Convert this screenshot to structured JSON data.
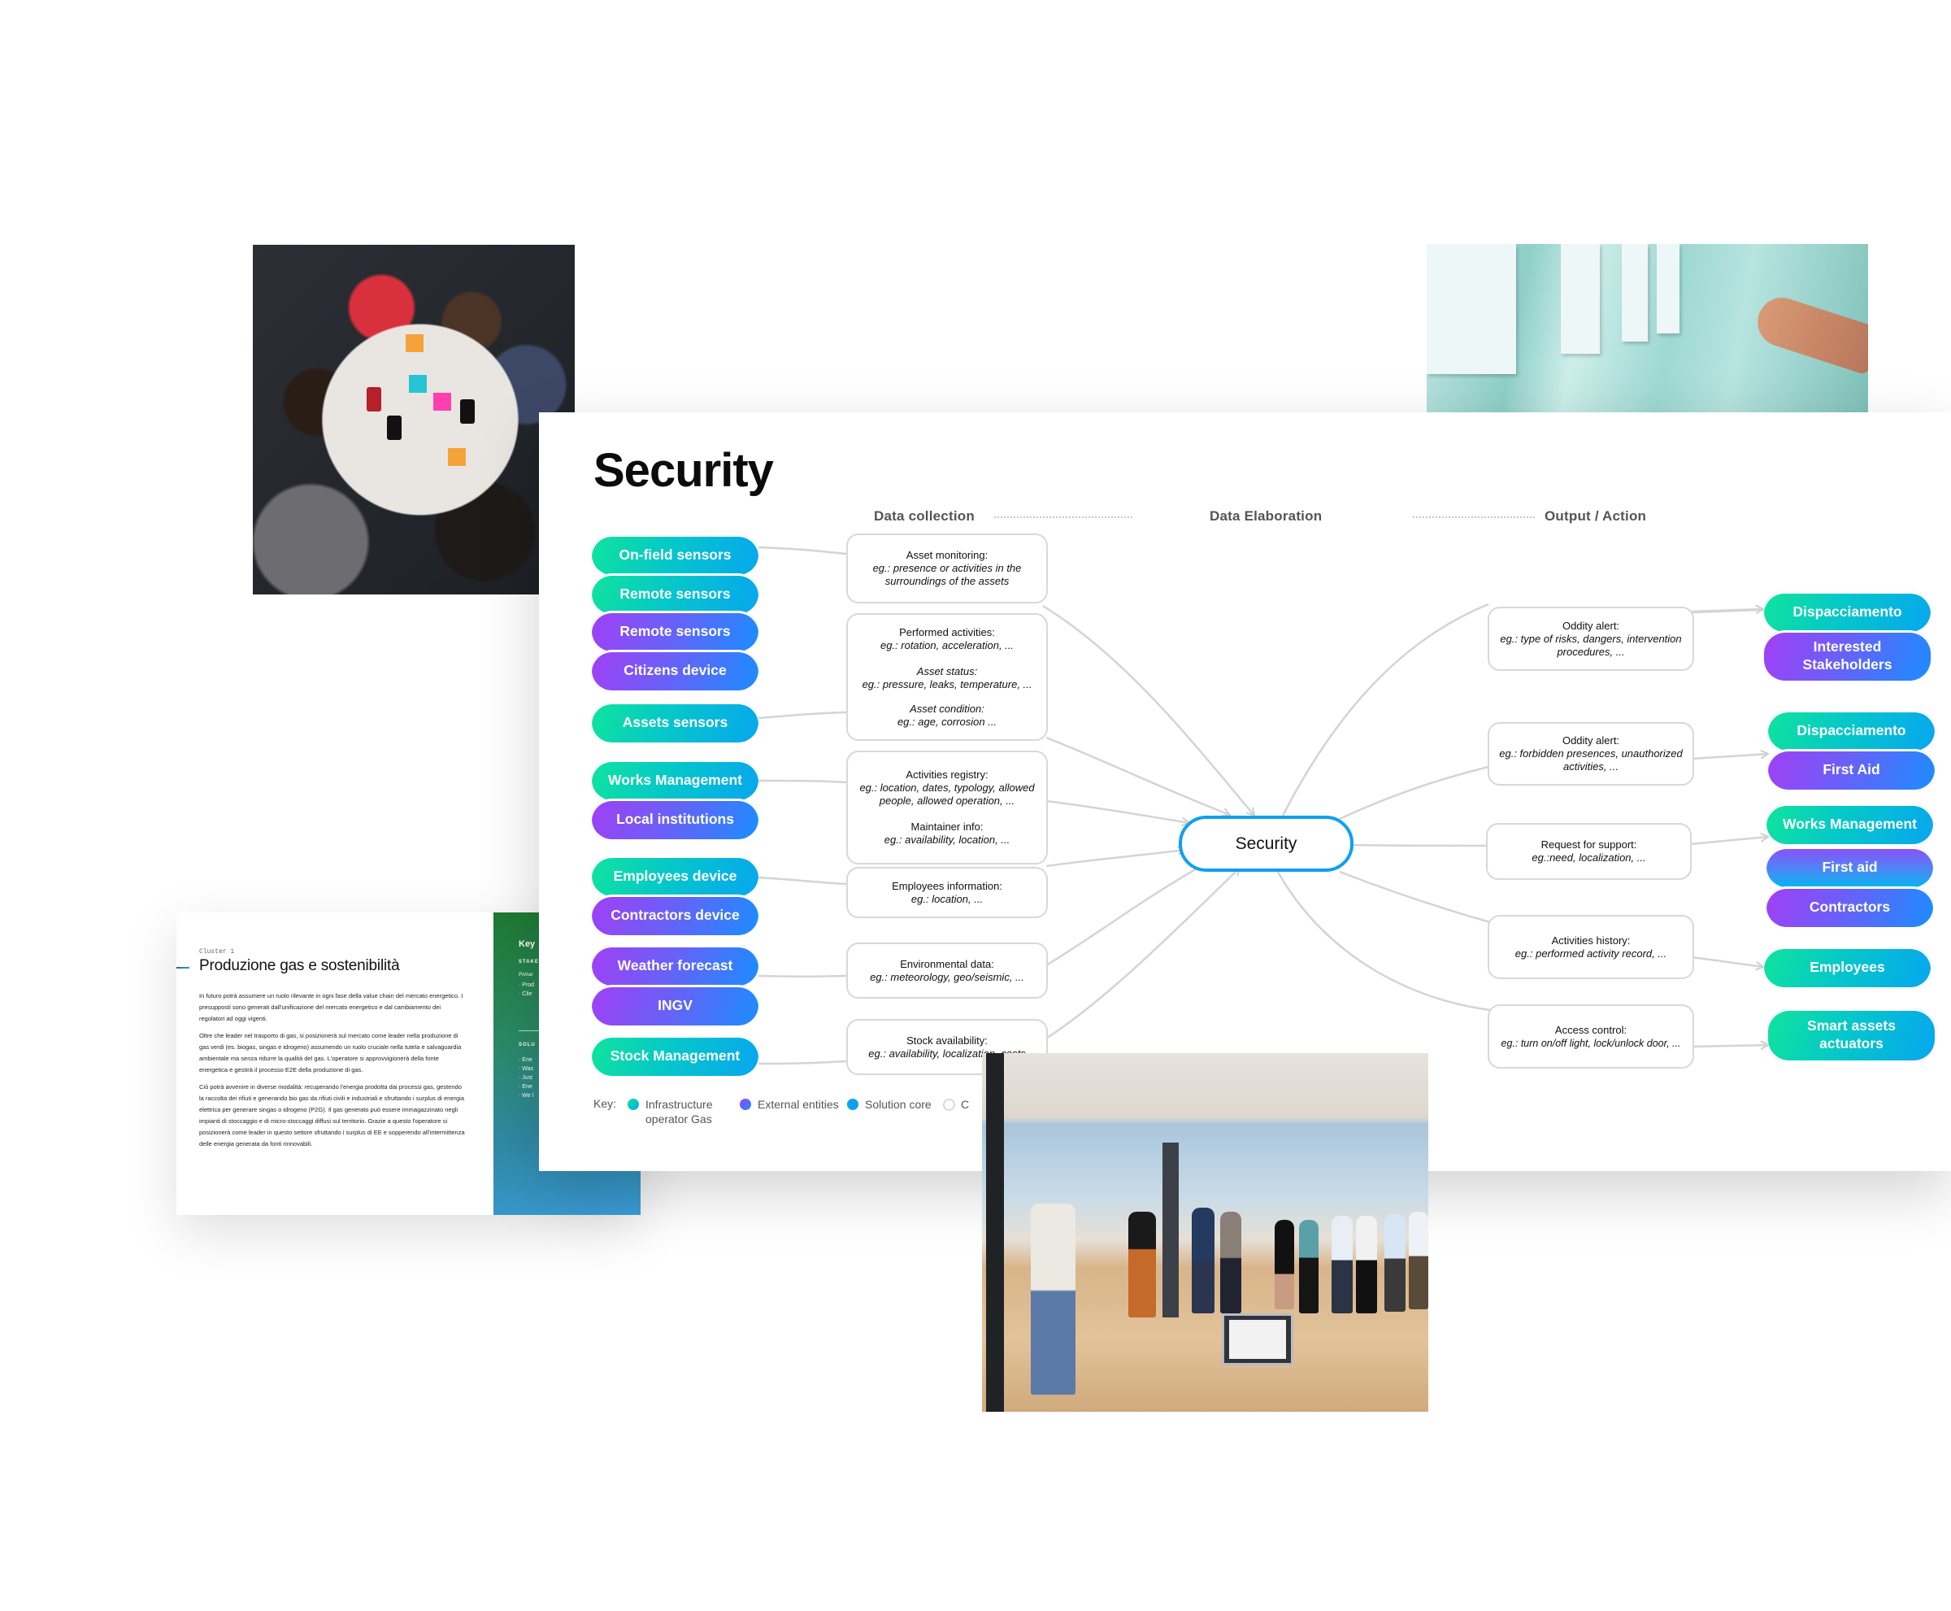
{
  "colors": {
    "teal_start": "#10e49c",
    "teal_end": "#07a6ef",
    "purple_start": "#a23ff6",
    "purple_end": "#1b8dff",
    "solution_core": "#0ea0f0",
    "connector": "#d0d0d0"
  },
  "diagram": {
    "title": "Security",
    "columns": {
      "data_collection": "Data collection",
      "data_elaboration": "Data Elaboration",
      "output_action": "Output / Action"
    },
    "center_node": "Security",
    "sources": [
      {
        "label": "On-field sensors",
        "type": "infrastructure"
      },
      {
        "label": "Remote sensors",
        "type": "infrastructure"
      },
      {
        "label": "Remote sensors",
        "type": "external"
      },
      {
        "label": "Citizens device",
        "type": "external"
      },
      {
        "label": "Assets sensors",
        "type": "infrastructure"
      },
      {
        "label": "Works Management",
        "type": "infrastructure"
      },
      {
        "label": "Local institutions",
        "type": "external"
      },
      {
        "label": "Employees device",
        "type": "infrastructure"
      },
      {
        "label": "Contractors device",
        "type": "external"
      },
      {
        "label": "Weather forecast",
        "type": "external"
      },
      {
        "label": "INGV",
        "type": "external"
      },
      {
        "label": "Stock Management",
        "type": "infrastructure"
      }
    ],
    "data_boxes": [
      {
        "blocks": [
          {
            "title": "Asset monitoring:",
            "example": "eg.: presence or activities in the surroundings of the assets"
          }
        ]
      },
      {
        "blocks": [
          {
            "title": "Performed activities:",
            "example": "eg.: rotation, acceleration, ..."
          },
          {
            "title": "Asset status:",
            "example": "eg.: pressure, leaks, temperature, ...",
            "title_italic": true
          },
          {
            "title": "Asset condition:",
            "example": "eg.: age, corrosion ...",
            "title_italic": true
          }
        ]
      },
      {
        "blocks": [
          {
            "title": "Activities registry:",
            "example": "eg.: location, dates, typology, allowed people, allowed operation, ..."
          },
          {
            "title": "Maintainer info:",
            "example": "eg.: availability, location, ..."
          }
        ]
      },
      {
        "blocks": [
          {
            "title": "Employees information:",
            "example": "eg.: location, ..."
          }
        ]
      },
      {
        "blocks": [
          {
            "title": "Environmental data:",
            "example": "eg.: meteorology, geo/seismic, ..."
          }
        ]
      },
      {
        "blocks": [
          {
            "title": "Stock availability:",
            "example": "eg.: availability, localization, costs"
          }
        ]
      }
    ],
    "output_boxes": [
      {
        "title": "Oddity alert:",
        "example": "eg.: type of risks, dangers, intervention procedures, ..."
      },
      {
        "title": "Oddity alert:",
        "example": "eg.: forbidden presences, unauthorized activities, ..."
      },
      {
        "title": "Request for support:",
        "example": "eg.:need, localization, ..."
      },
      {
        "title": "Activities history:",
        "example": "eg.: performed activity record, ..."
      },
      {
        "title": "Access control:",
        "example": "eg.: turn on/off light, lock/unlock door, ..."
      }
    ],
    "targets": [
      {
        "label": "Dispacciamento",
        "type": "infrastructure"
      },
      {
        "label": "Interested Stakeholders",
        "type": "external"
      },
      {
        "label": "Dispacciamento",
        "type": "infrastructure"
      },
      {
        "label": "First Aid",
        "type": "external"
      },
      {
        "label": "Works Management",
        "type": "infrastructure"
      },
      {
        "label": "First aid",
        "type": "external"
      },
      {
        "label": "Contractors",
        "type": "external"
      },
      {
        "label": "Employees",
        "type": "infrastructure"
      },
      {
        "label": "Smart assets actuators",
        "type": "infrastructure"
      }
    ],
    "legend": {
      "key_label": "Key:",
      "items": [
        {
          "label": "Infrastructure operator Gas",
          "kind": "infrastructure"
        },
        {
          "label": "External entities",
          "kind": "external"
        },
        {
          "label": "Solution core",
          "kind": "core"
        },
        {
          "label": "C",
          "kind": "other"
        }
      ]
    }
  },
  "document": {
    "cluster_label": "Cluster 1",
    "title": "Produzione gas e sostenibilità",
    "paragraphs": [
      "In futuro potrà assumere un ruolo rilevante in ogni fase della value chain del mercato energetico. I presupposti sono generati dall'unificazione del mercato energetico e dal cambiamento dei regolatori ad oggi vigenti.",
      "Oltre che leader nel trasporto di gas, si posizionerà sul mercato come leader nella produzione di gas verdi (es. biogas, singas e idrogeno) assumendo un ruolo cruciale nella tutela e salvaguardia ambientale ma senza ridurre la qualità del gas. L'operatore si approvvigionerà della fonte energetica e gestirà il processo E2E della produzione di gas.",
      "Ciò potrà avvenire in diverse modalità: recuperando l'energia prodotta dai processi gas, gestendo la raccolta dei rifiuti e generando bio gas da rifiuti civili e industriali e sfruttando i surplus di energia elettrica per generare singas o idrogeno (P2G). Il gas generato può essere immagazzinato negli impianti di stoccaggio e di micro-stoccaggi diffusi sul territorio. Grazie a questo l'operatore si posizionerà come leader in questo settore sfruttando i surplus di EE e sopperendo all'intermittenza delle energia generata da fonti rinnovabili."
    ],
    "sidebar": {
      "key": "Key",
      "stakeholders_caption": "STAKE",
      "primary_label": "Primar",
      "stakeholder_items": [
        "Prod",
        "Clie"
      ],
      "solution_caption": "SOLU",
      "solution_items": [
        "Ene",
        "Was",
        "Just",
        "Ene",
        "We l"
      ]
    }
  },
  "photos": {
    "group_table": "workshop-table-photo",
    "wall_notes": "wall-notes-photo",
    "room_presentation": "presentation-room-photo"
  }
}
